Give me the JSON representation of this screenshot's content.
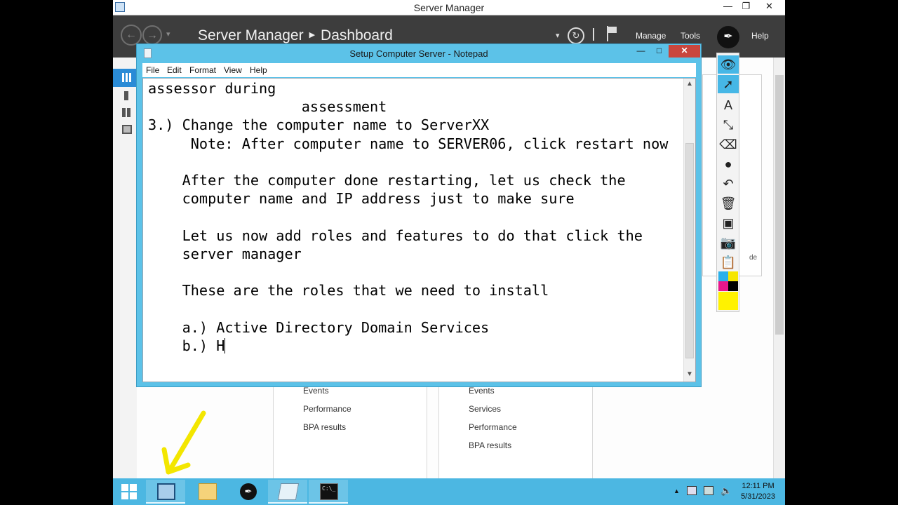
{
  "server_manager": {
    "window_title": "Server Manager",
    "breadcrumb_app": "Server Manager",
    "breadcrumb_page": "Dashboard",
    "header_menu": [
      "Manage",
      "Tools",
      "Help"
    ],
    "win_controls": [
      "—",
      "❐",
      "✕"
    ],
    "side_panel_text": "de"
  },
  "tiles": [
    {
      "links": [
        "Events",
        "Performance",
        "BPA results"
      ]
    },
    {
      "links": [
        "Events",
        "Services",
        "Performance",
        "BPA results"
      ]
    }
  ],
  "notepad": {
    "window_title": "Setup Computer Server - Notepad",
    "menu": [
      "File",
      "Edit",
      "Format",
      "View",
      "Help"
    ],
    "controls": [
      "—",
      "□",
      "✕"
    ],
    "lines": [
      "assessor during",
      "                  assessment",
      "3.) Change the computer name to ServerXX",
      "     Note: After computer name to SERVER06, click restart now",
      "",
      "    After the computer done restarting, let us check the",
      "    computer name and IP address just to make sure",
      "",
      "    Let us now add roles and features to do that click the",
      "    server manager",
      "",
      "    These are the roles that we need to install",
      "",
      "    a.) Active Directory Domain Services"
    ],
    "last_line": "    b.) H"
  },
  "annotation_toolbar": {
    "tools": [
      "eye-icon",
      "cursor-icon",
      "text-icon",
      "arrow-line-icon",
      "eraser-icon",
      "dot-icon",
      "undo-icon",
      "trash-icon",
      "board-icon",
      "camera-icon",
      "clipboard-icon"
    ],
    "colors": [
      "#2ab0e9",
      "#f6e600",
      "#e8168b",
      "#000000"
    ],
    "selected_color": "#fff200"
  },
  "taskbar": {
    "time": "12:11 PM",
    "date": "5/31/2023"
  },
  "colors": {
    "taskbar": "#4cb7e2",
    "notepad_frame": "#5cc2e8",
    "sm_header": "#3d3d3d",
    "highlight_arrow": "#f3e600"
  }
}
